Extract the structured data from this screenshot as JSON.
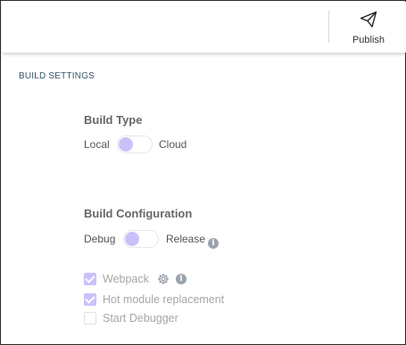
{
  "toolbar": {
    "publish_label": "Publish",
    "publish_icon": "paper-plane-icon"
  },
  "build_settings": {
    "section_title": "BUILD SETTINGS",
    "build_type": {
      "title": "Build Type",
      "left_label": "Local",
      "right_label": "Cloud",
      "selected": "Local"
    },
    "build_configuration": {
      "title": "Build Configuration",
      "left_label": "Debug",
      "right_label": "Release",
      "selected": "Debug"
    },
    "options": [
      {
        "label": "Webpack",
        "checked": true,
        "disabled": true
      },
      {
        "label": "Hot module replacement",
        "checked": true,
        "disabled": true
      },
      {
        "label": "Start Debugger",
        "checked": false,
        "disabled": true
      }
    ]
  },
  "colors": {
    "accent": "#cbc1fa",
    "section_title": "#35566b",
    "info_icon": "#9aa3ab"
  }
}
